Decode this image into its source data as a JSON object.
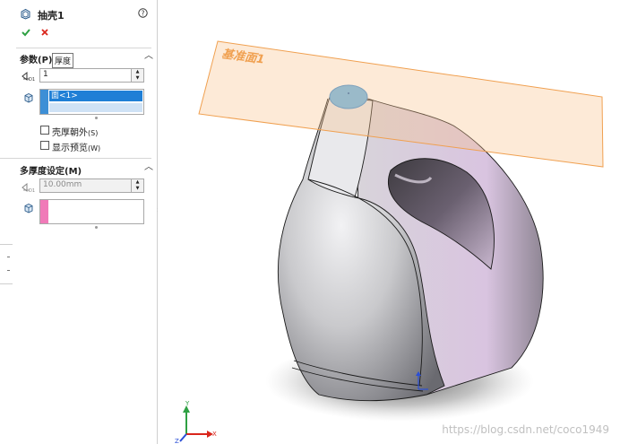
{
  "feature": {
    "title": "抽壳1",
    "help_icon": "help-circle-icon",
    "ok_icon": "checkmark-icon",
    "cancel_icon": "close-icon",
    "ok_color": "#2ea043",
    "cancel_color": "#d9261c"
  },
  "parameters": {
    "section_title": "参数(P)",
    "tooltip": "厚度",
    "thickness_value": "1",
    "faces": [
      "面<1>"
    ],
    "shell_outward_label": "壳厚朝外",
    "shell_outward_key": "(S)",
    "preview_label": "显示预览",
    "preview_key": "(W)"
  },
  "multi_thickness": {
    "section_title": "多厚度设定(M)",
    "thickness_value": "10.00mm"
  },
  "viewport": {
    "plane_label": "基准面1",
    "plane_color": "#f0a050",
    "selected_face_color": "#67b5ea",
    "axis_x": "X",
    "axis_y": "Y",
    "axis_z": "Z",
    "watermark": "https://blog.csdn.net/coco1949"
  }
}
